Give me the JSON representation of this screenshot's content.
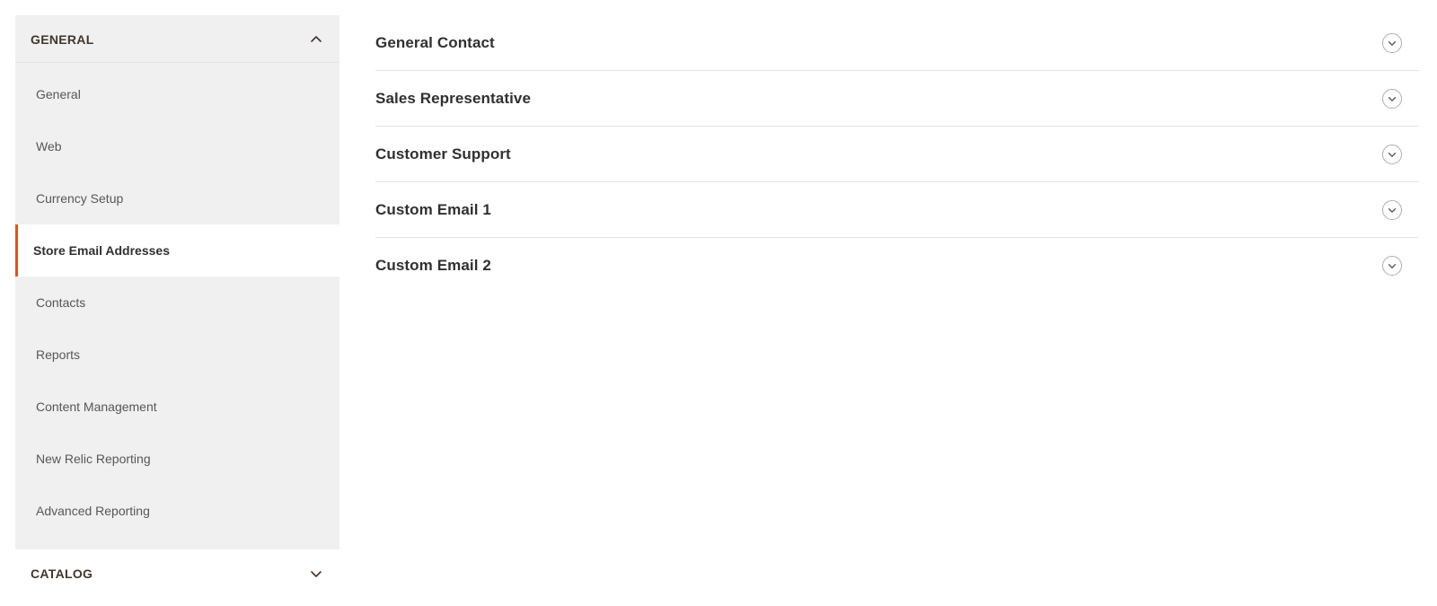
{
  "sidebar": {
    "sections": [
      {
        "label": "GENERAL",
        "expanded": true,
        "toggle_icon": "chevron-up-icon",
        "items": [
          {
            "label": "General",
            "active": false
          },
          {
            "label": "Web",
            "active": false
          },
          {
            "label": "Currency Setup",
            "active": false
          },
          {
            "label": "Store Email Addresses",
            "active": true
          },
          {
            "label": "Contacts",
            "active": false
          },
          {
            "label": "Reports",
            "active": false
          },
          {
            "label": "Content Management",
            "active": false
          },
          {
            "label": "New Relic Reporting",
            "active": false
          },
          {
            "label": "Advanced Reporting",
            "active": false
          }
        ]
      },
      {
        "label": "CATALOG",
        "expanded": false,
        "toggle_icon": "chevron-down-icon",
        "items": []
      }
    ]
  },
  "main": {
    "sections": [
      {
        "title": "General Contact",
        "toggle_icon": "chevron-down-circle-icon",
        "expanded": false
      },
      {
        "title": "Sales Representative",
        "toggle_icon": "chevron-down-circle-icon",
        "expanded": false
      },
      {
        "title": "Customer Support",
        "toggle_icon": "chevron-down-circle-icon",
        "expanded": false
      },
      {
        "title": "Custom Email 1",
        "toggle_icon": "chevron-down-circle-icon",
        "expanded": false
      },
      {
        "title": "Custom Email 2",
        "toggle_icon": "chevron-down-circle-icon",
        "expanded": false
      }
    ]
  },
  "colors": {
    "accent": "#eb5202",
    "sidebar_bg": "#f0f0f0",
    "page_bg": "#ffffff",
    "divider": "#e3e3e3",
    "text_primary": "#303030",
    "text_secondary": "#575757"
  }
}
